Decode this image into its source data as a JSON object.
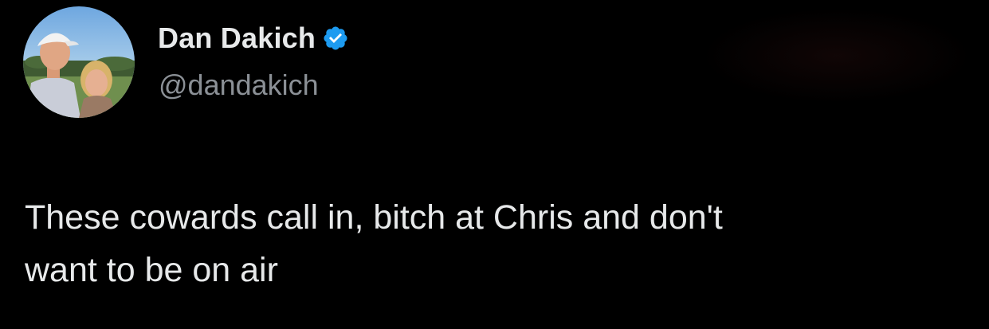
{
  "author": {
    "display_name": "Dan Dakich",
    "handle": "@dandakich",
    "verified": true,
    "avatar_icon": "profile-photo"
  },
  "tweet": {
    "text": "These cowards call in, bitch at Chris and don't\nwant to be on air"
  },
  "colors": {
    "background": "#000000",
    "primary_text": "#e7e9ea",
    "secondary_text": "#8b9096",
    "verified_badge": "#1d9bf0"
  }
}
